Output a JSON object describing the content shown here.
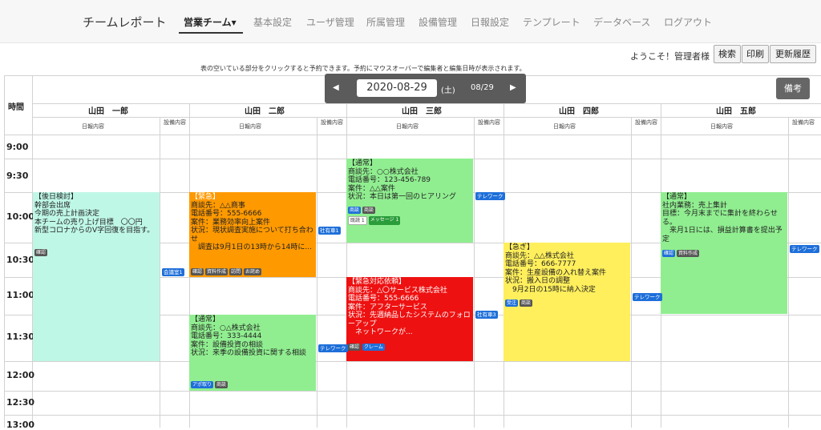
{
  "nav": {
    "brand": "チームレポート",
    "items": [
      {
        "label": "営業チーム▾",
        "active": true
      },
      {
        "label": "基本設定"
      },
      {
        "label": "ユーザ管理"
      },
      {
        "label": "所属管理"
      },
      {
        "label": "設備管理"
      },
      {
        "label": "日報設定"
      },
      {
        "label": "テンプレート"
      },
      {
        "label": "データベース"
      },
      {
        "label": "ログアウト"
      }
    ]
  },
  "toolbar": {
    "welcome": "ようこそ！管理者様",
    "search": "検索",
    "print": "印刷",
    "history": "更新履歴"
  },
  "instruction": "表の空いている部分をクリックすると予約できます。予約にマウスオーバーで編集者と編集日時が表示されます。",
  "date_bar": {
    "prev": "◀",
    "date": "2020-08-29",
    "dow": "(土)",
    "short": "08/29",
    "next": "▶"
  },
  "memo_button": "備考",
  "grid": {
    "time_header": "時間",
    "col_report": "日報内容",
    "col_equip": "設備内容",
    "people": [
      "山田　一郎",
      "山田　二郎",
      "山田　三郎",
      "山田　四郎",
      "山田　五郎"
    ],
    "times": [
      "9:00",
      "9:30",
      "10:00",
      "10:30",
      "11:00",
      "11:30",
      "12:00",
      "12:30",
      "13:00"
    ]
  },
  "cards": [
    {
      "lines": [
        "【後日検討】",
        "幹部会出席",
        "今期の売上計画決定",
        "本チームの売り上げ目標　〇〇円",
        "新型コロナからのV字回復を目指す。"
      ],
      "tags": [
        "確認"
      ]
    },
    {
      "lines": [
        "【緊急】",
        "商談先：△△商事",
        "電話番号：555-6666",
        "案件：業務効率向上案件",
        "状況：現状調査実施について打ち合わせ",
        "　調査は9月1日の13時から14時に..."
      ],
      "tags": [
        "確認",
        "資料作成",
        "訪問",
        "お詫め"
      ]
    },
    {
      "lines": [
        "【通常】",
        "商談先：○△株式会社",
        "電話番号：333-4444",
        "案件：設備投資の相談",
        "状況：来季の設備投資に関する相談"
      ],
      "tags": [
        "アポ取り",
        "商談"
      ]
    },
    {
      "lines": [
        "【通常】",
        "商談先：○○株式会社",
        "電話番号：123-456-789",
        "案件：△△案件",
        "状況：本日は第一回のヒアリング"
      ],
      "tags": [
        "商談",
        "商談"
      ],
      "tags2": [
        "既読 1",
        "メッセージ 1"
      ]
    },
    {
      "lines": [
        "【緊急対応依頼】",
        "商談先：△〇サービス株式会社",
        "電話番号：555-6666",
        "案件：アフターサービス",
        "状況：先週納品したシステムのフォローアップ",
        "　ネットワークが..."
      ],
      "tags": [
        "確認",
        "クレーム"
      ]
    },
    {
      "lines": [
        "【急ぎ】",
        "商談先：△△株式会社",
        "電話番号：666-7777",
        "案件：生産設備の入れ替え案件",
        "状況：搬入日の調整",
        "　9月2日の15時に納入決定"
      ],
      "tags": [
        "受注",
        "商談"
      ]
    },
    {
      "lines": [
        "【通常】",
        "社内業務：売上集計",
        "目標：今月末までに集計を終わらせる。",
        "　来月1日には、損益計算書を提出予定"
      ],
      "tags": [
        "確認",
        "資料作成"
      ]
    }
  ],
  "equipment": {
    "kaigi1": "会議室1",
    "shayou1": "社有車1",
    "tele1": "テレワーク",
    "shayou3": "社有車3",
    "tele2": "テレワーク",
    "tele3": "テレワーク",
    "tele4": "テレワーク"
  },
  "colors": {
    "mint": "#bff7e6",
    "orange": "#ff9900",
    "green": "#90ee90",
    "red": "#ee1111",
    "yellow": "#ffef5c"
  }
}
